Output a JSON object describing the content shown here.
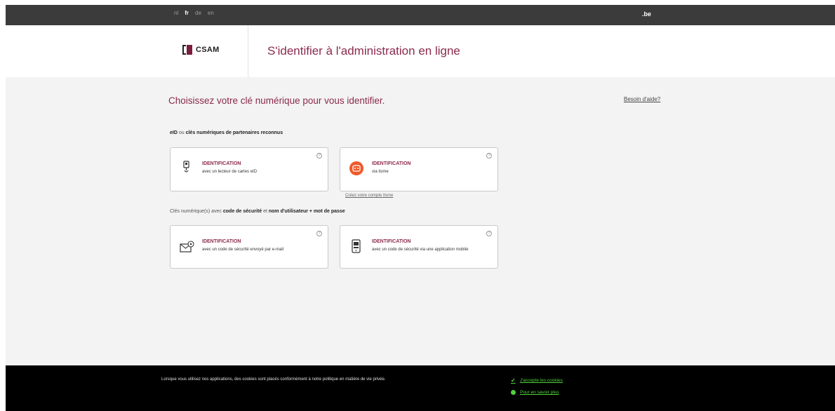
{
  "topbar": {
    "languages": [
      "nl",
      "fr",
      "de",
      "en"
    ],
    "active_language": "fr",
    "domain_label": ".be"
  },
  "header": {
    "logo_text": "CSAM",
    "title": "S'identifier à l'administration en ligne"
  },
  "main": {
    "heading": "Choisissez votre clé numérique pour vous identifier.",
    "help_link": "Besoin d'aide?",
    "section1": {
      "part1": "eID",
      "part2": " ou ",
      "part3": "clés numériques de partenaires reconnus"
    },
    "section2": {
      "part1": "Clés numérique(s) avec ",
      "part2": "code de sécurité",
      "part3": " et ",
      "part4": "nom d'utilisateur + mot de passe"
    },
    "cards": [
      {
        "title": "IDENTIFICATION",
        "subtitle": "avec un lecteur de cartes eID",
        "icon": "card-reader-icon"
      },
      {
        "title": "IDENTIFICATION",
        "subtitle": "via itsme",
        "icon": "itsme-icon"
      },
      {
        "title": "IDENTIFICATION",
        "subtitle": "avec un code de sécurité envoyé par e-mail",
        "icon": "email-icon"
      },
      {
        "title": "IDENTIFICATION",
        "subtitle": "avec un code de sécurité via une application mobile",
        "icon": "mobile-app-icon"
      }
    ],
    "itsme_create_link": "Créez votre compte itsme"
  },
  "footer": {
    "text": "Lorsque vous utilisez nos applications, des cookies sont placés conformément à notre politique en matière de vie privée.",
    "accept_label": "J'accepte les cookies",
    "more_label": "Pour en savoir plus"
  },
  "colors": {
    "accent": "#8b2a4d",
    "cookie_green": "#4fd43a"
  }
}
